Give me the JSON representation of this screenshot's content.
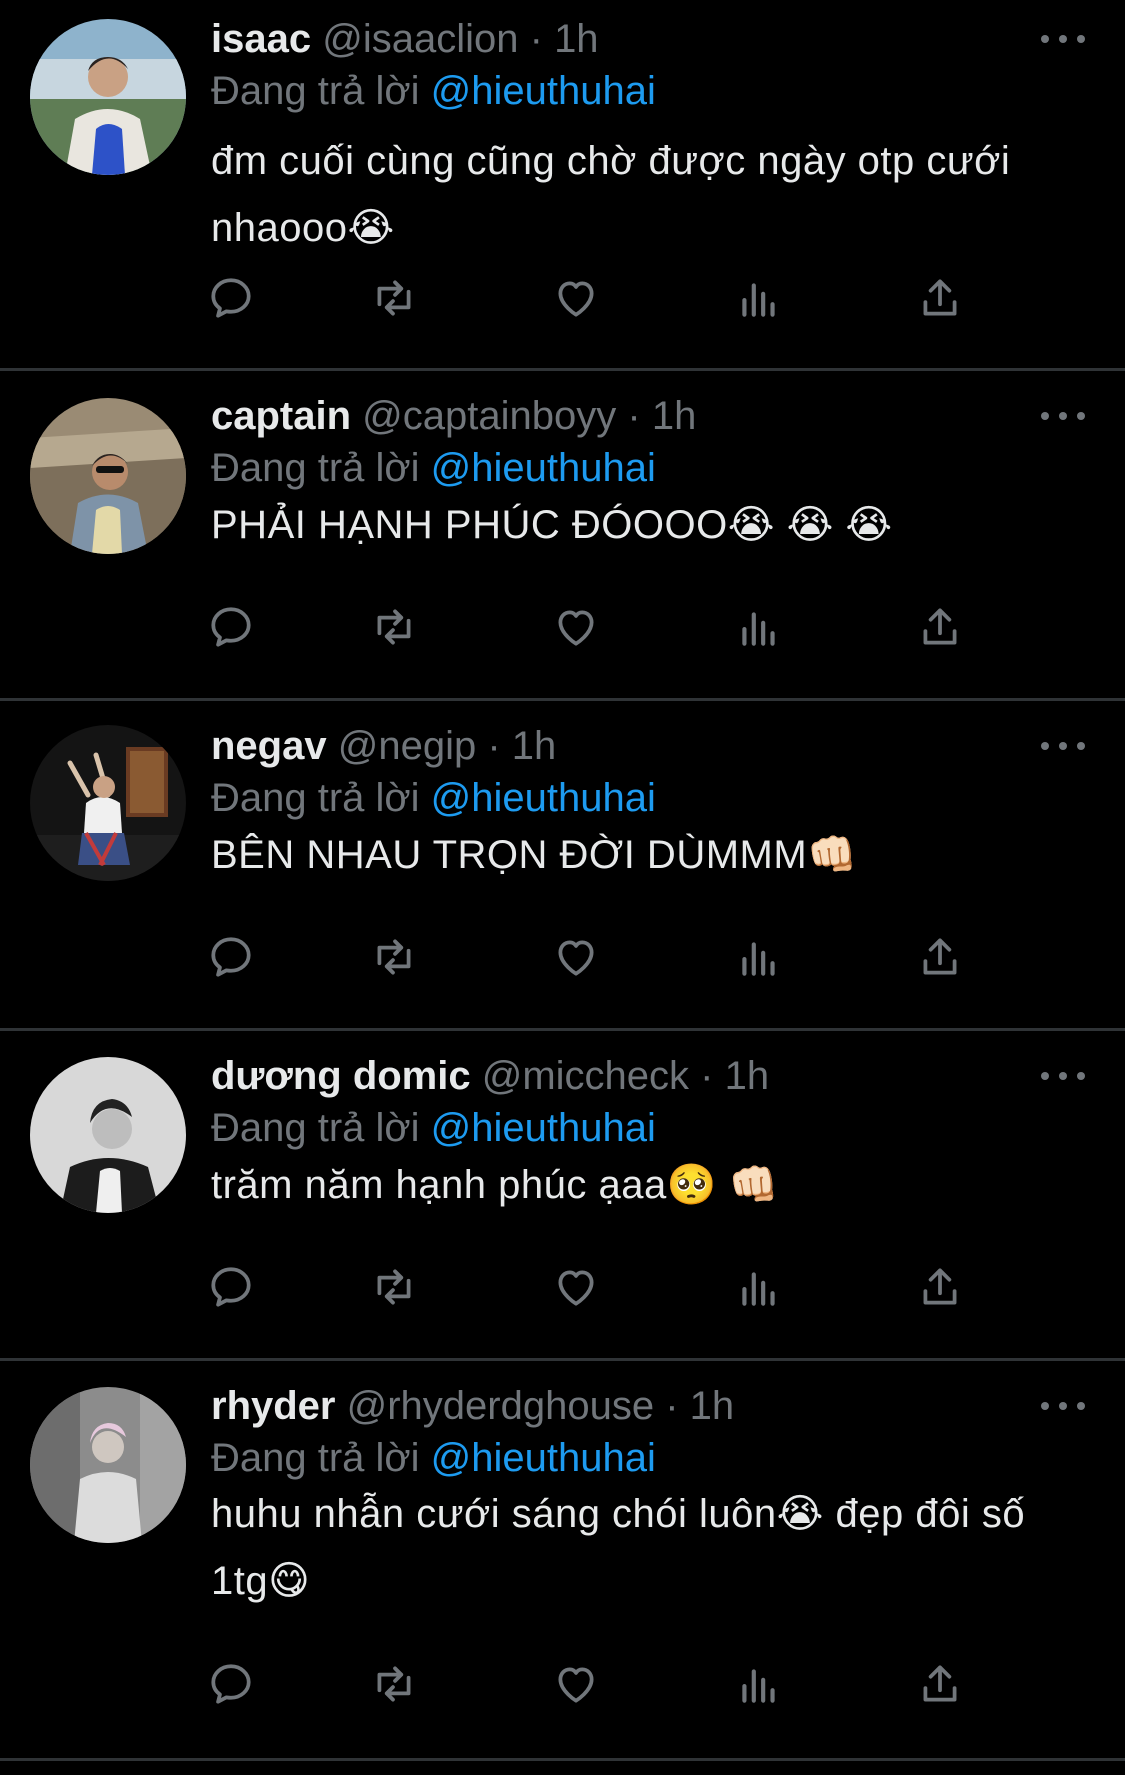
{
  "reply_prefix": "Đang trả lời",
  "colors": {
    "background": "#000000",
    "text": "#e7e9ea",
    "muted": "#71767b",
    "link": "#1d9bf0",
    "divider": "#2f3336"
  },
  "action_icons": [
    "reply-icon",
    "retweet-icon",
    "like-icon",
    "views-icon",
    "share-icon"
  ],
  "tweets": [
    {
      "name": "isaac",
      "handle": "@isaaclion",
      "dot": "·",
      "time": "1h",
      "reply_to": "@hieuthuhai",
      "body": "đm cuối cùng cũng chờ được ngày otp cưới nhaooo😭"
    },
    {
      "name": "captain",
      "handle": "@captainboyy",
      "dot": "·",
      "time": "1h",
      "reply_to": "@hieuthuhai",
      "body": "PHẢI HẠNH PHÚC ĐÓOOO😭 😭 😭"
    },
    {
      "name": "negav",
      "handle": "@negip",
      "dot": "·",
      "time": "1h",
      "reply_to": "@hieuthuhai",
      "body": "BÊN NHAU TRỌN ĐỜI DÙMMM👊🏻"
    },
    {
      "name": "dương domic",
      "handle": "@miccheck",
      "dot": "·",
      "time": "1h",
      "reply_to": "@hieuthuhai",
      "body": "trăm năm hạnh phúc ạaa🥺 👊🏻"
    },
    {
      "name": "rhyder",
      "handle": "@rhyderdghouse",
      "dot": "·",
      "time": "1h",
      "reply_to": "@hieuthuhai",
      "body": "huhu nhẫn cưới sáng chói luôn😭  đẹp đôi số 1tg😋"
    }
  ]
}
